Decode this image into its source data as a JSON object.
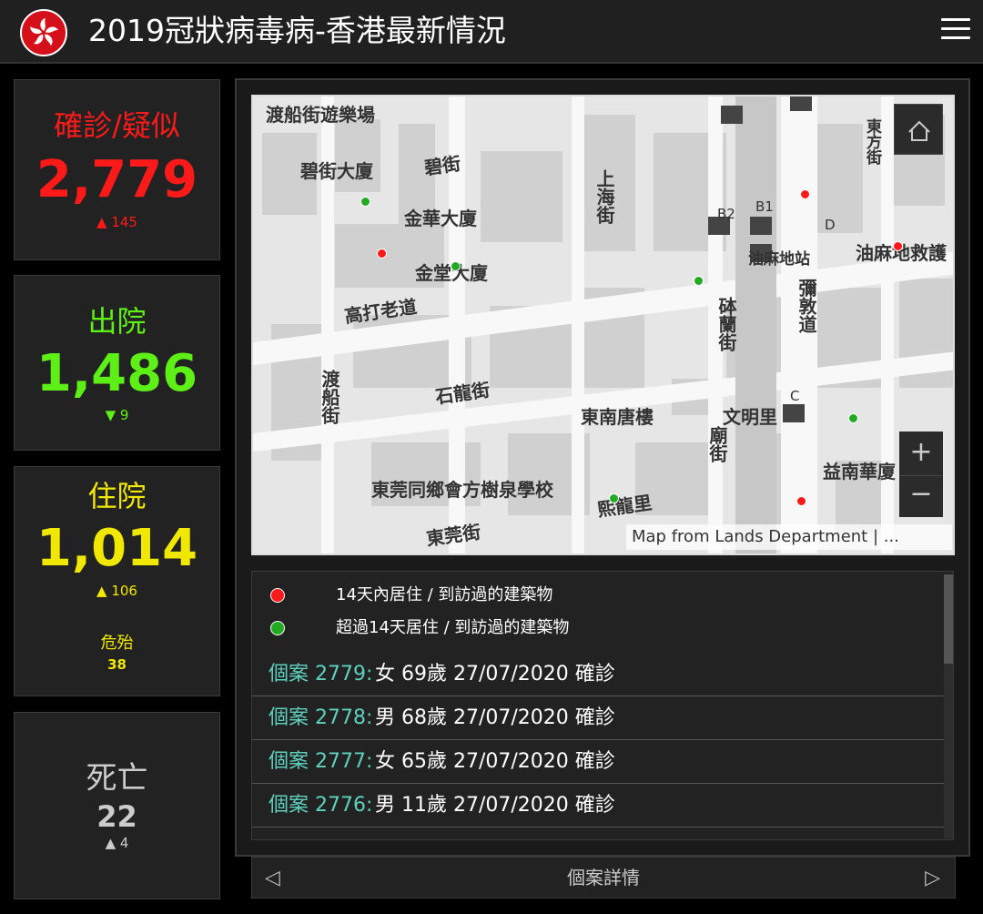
{
  "header": {
    "title": "2019冠狀病毒病-香港最新情況",
    "logo_icon": "hksar-bauhinia-logo",
    "menu_icon": "hamburger-menu-icon"
  },
  "stats": {
    "confirmed": {
      "label": "確診/疑似",
      "value": "2,779",
      "delta": "▲ 145",
      "color": "#ff1a1a"
    },
    "discharged": {
      "label": "出院",
      "value": "1,486",
      "delta": "▼ 9",
      "color": "#5ef016"
    },
    "hospitalised": {
      "label": "住院",
      "value": "1,014",
      "delta": "▲ 106",
      "color": "#f0e800",
      "critical_label": "危殆",
      "critical_value": "38"
    },
    "deaths": {
      "label": "死亡",
      "value": "22",
      "delta": "▲ 4",
      "color": "#cccccc"
    }
  },
  "map": {
    "labels": [
      "渡船街遊樂場",
      "碧街大廈",
      "碧街",
      "金華大廈",
      "金堂大廈",
      "高打老道",
      "石龍街",
      "渡船街",
      "東南唐樓",
      "文明里",
      "東莞同鄉會方樹泉學校",
      "熙龍里",
      "東莞街",
      "上海街",
      "東方街",
      "油麻地站",
      "油麻地救護",
      "彌敦道",
      "益南華廈",
      "廟街",
      "砵蘭街",
      "B2",
      "B1",
      "D",
      "C"
    ],
    "attribution": "Map from Lands Department | ...",
    "zoom_in": "+",
    "zoom_out": "−",
    "home_icon": "home-icon",
    "markers": [
      {
        "color": "#ff1a1a"
      },
      {
        "color": "#ff1a1a"
      },
      {
        "color": "#ff1a1a"
      },
      {
        "color": "#ff1a1a"
      },
      {
        "color": "#22aa22"
      },
      {
        "color": "#22aa22"
      },
      {
        "color": "#22aa22"
      },
      {
        "color": "#22aa22"
      },
      {
        "color": "#22aa22"
      }
    ]
  },
  "legend": [
    {
      "color": "#ff1a1a",
      "text": "14天內居住 / 到訪過的建築物"
    },
    {
      "color": "#22aa22",
      "text": "超過14天居住 / 到訪過的建築物"
    }
  ],
  "cases": [
    {
      "case": "個案 2779:",
      "info": "女  69歲  27/07/2020 確診"
    },
    {
      "case": "個案 2778:",
      "info": "男  68歲  27/07/2020 確診"
    },
    {
      "case": "個案 2777:",
      "info": "女  65歲  27/07/2020 確診"
    },
    {
      "case": "個案 2776:",
      "info": "男  11歲  27/07/2020 確診"
    }
  ],
  "footer": {
    "title": "個案詳情",
    "prev": "◁",
    "next": "▷"
  }
}
